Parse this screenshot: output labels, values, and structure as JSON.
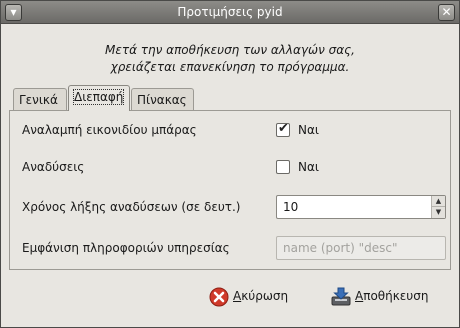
{
  "window": {
    "title": "Προτιμήσεις pyid",
    "menu_glyph": "▾",
    "close_glyph": "✕"
  },
  "info": {
    "line1": "Μετά την αποθήκευση των αλλαγών σας,",
    "line2": "χρειάζεται επανεκίνηση το πρόγραμμα."
  },
  "tabs": [
    {
      "label": "Γενικά",
      "active": false
    },
    {
      "label": "Διεπαφή",
      "active": true
    },
    {
      "label": "Πίνακας",
      "active": false
    }
  ],
  "settings": {
    "tray_icon": {
      "label": "Αναλαμπή εικονιδίου μπάρας",
      "checked": true,
      "option": "Ναι"
    },
    "popups": {
      "label": "Αναδύσεις",
      "checked": false,
      "option": "Ναι"
    },
    "popup_timeout": {
      "label": "Χρόνος λήξης αναδύσεων (σε δευτ.)",
      "value": "10"
    },
    "service_info": {
      "label": "Εμφάνιση πληροφοριών υπηρεσίας",
      "placeholder": "name (port) \"desc\""
    }
  },
  "buttons": {
    "cancel": {
      "mnemonic": "Α",
      "rest": "κύρωση",
      "icon": "cancel-icon"
    },
    "save": {
      "mnemonic": "Α",
      "rest": "ποθήκευση",
      "icon": "save-icon"
    }
  },
  "colors": {
    "titlebar": "#7b7a76",
    "window_bg": "#e8e6e1",
    "cancel_icon": "#d03a2a",
    "save_icon": "#3a6fb8"
  }
}
